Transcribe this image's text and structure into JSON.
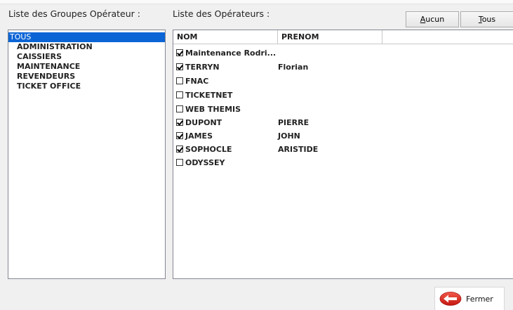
{
  "labels": {
    "groupes": "Liste des Groupes Opérateur :",
    "operateurs": "Liste des Opérateurs :"
  },
  "buttons": {
    "aucun_first": "A",
    "aucun_rest": "ucun",
    "tous_first": "T",
    "tous_rest": "ous",
    "fermer": "Fermer"
  },
  "groups": [
    {
      "label": "TOUS",
      "selected": true
    },
    {
      "label": "ADMINISTRATION"
    },
    {
      "label": "CAISSIERS"
    },
    {
      "label": "MAINTENANCE"
    },
    {
      "label": "REVENDEURS"
    },
    {
      "label": "TICKET OFFICE"
    }
  ],
  "columns": {
    "nom": "NOM",
    "prenom": "PRENOM"
  },
  "operators": [
    {
      "nom": "Maintenance Rodri...",
      "prenom": "",
      "checked": true
    },
    {
      "nom": "TERRYN",
      "prenom": "Florian",
      "checked": true
    },
    {
      "nom": "FNAC",
      "prenom": "",
      "checked": false
    },
    {
      "nom": "TICKETNET",
      "prenom": "",
      "checked": false
    },
    {
      "nom": "WEB THEMIS",
      "prenom": "",
      "checked": false
    },
    {
      "nom": "DUPONT",
      "prenom": "PIERRE",
      "checked": true
    },
    {
      "nom": "JAMES",
      "prenom": "JOHN",
      "checked": true
    },
    {
      "nom": "SOPHOCLE",
      "prenom": "ARISTIDE",
      "checked": true
    },
    {
      "nom": "ODYSSEY",
      "prenom": "",
      "checked": false
    }
  ],
  "icons": {
    "fermer": "back-arrow-icon"
  },
  "colors": {
    "selection": "#0a64d6",
    "close_icon": "#d9261c"
  }
}
